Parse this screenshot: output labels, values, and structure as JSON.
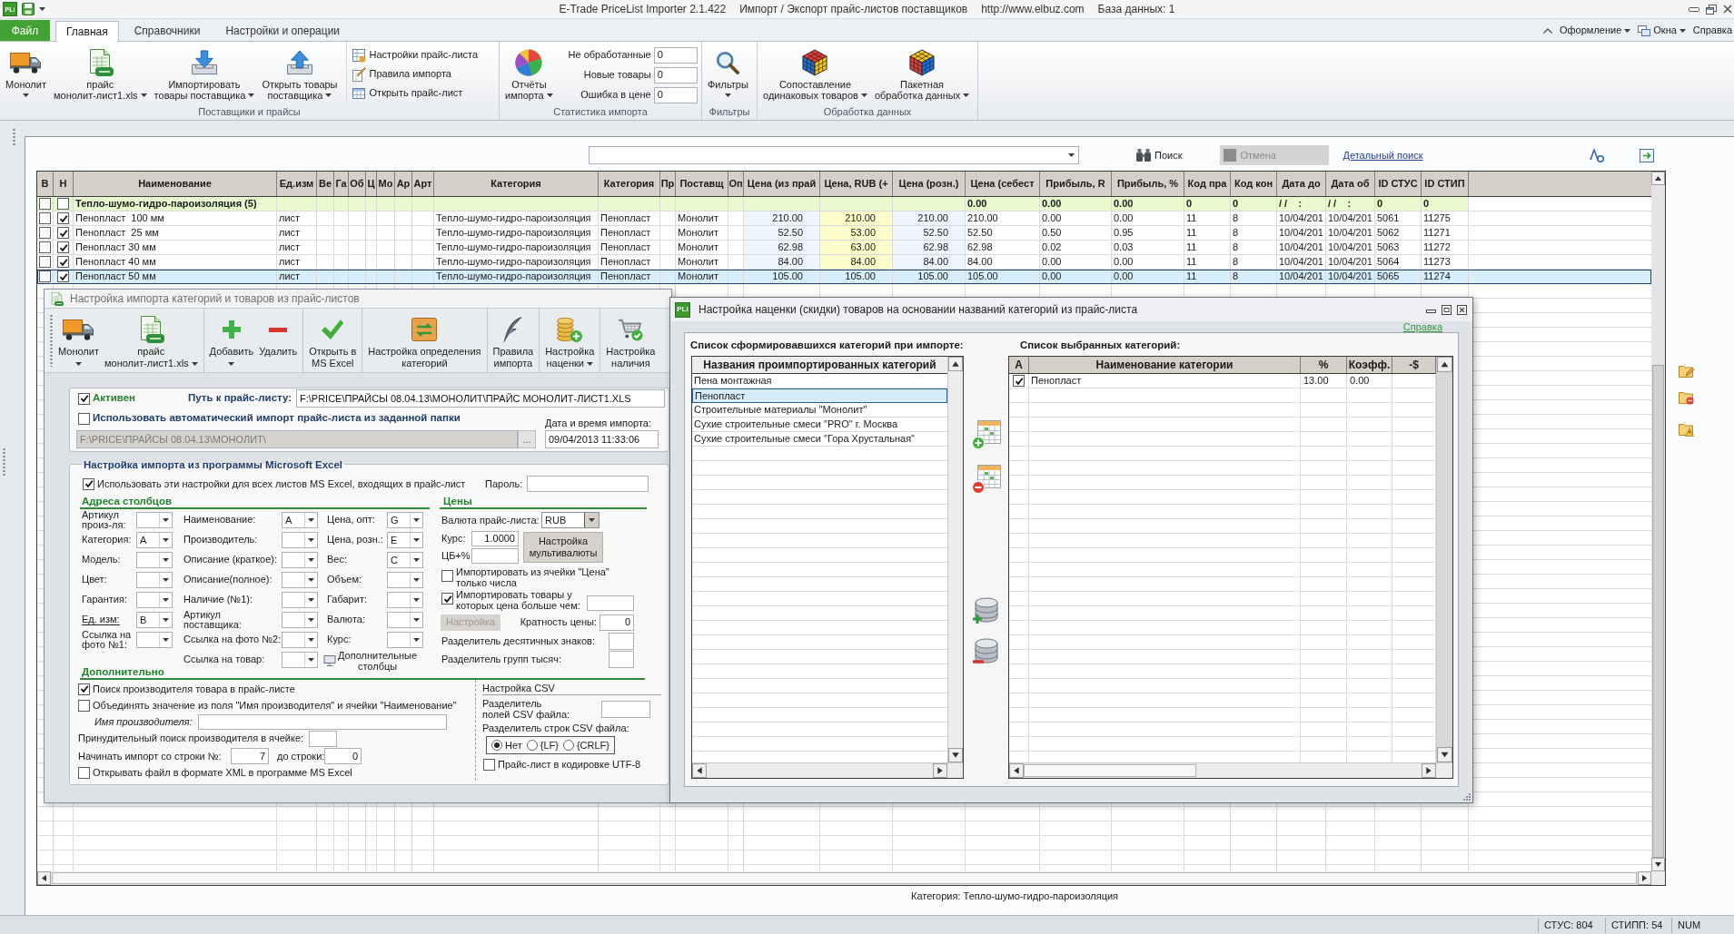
{
  "window": {
    "logo": "PLi",
    "title": "E-Trade PriceList Importer 2.1.422",
    "subtitle": "Импорт / Экспорт прайс-листов поставщиков",
    "website": "http://www.elbuz.com",
    "database": "База данных: 1"
  },
  "ribbon": {
    "tabs": [
      {
        "label": "Файл",
        "kind": "file",
        "selected": false
      },
      {
        "label": "Главная",
        "kind": "tab",
        "selected": true
      },
      {
        "label": "Справочники",
        "kind": "tab",
        "selected": false
      },
      {
        "label": "Настройки и операции",
        "kind": "tab",
        "selected": false
      }
    ],
    "menus": [
      {
        "label": "Оформление",
        "dropdown": true
      },
      {
        "label": "Окна",
        "dropdown": true
      },
      {
        "label": "Справка",
        "dropdown": false
      }
    ],
    "groups": [
      {
        "label": "Поставщики и прайсы",
        "items": [
          {
            "kind": "large",
            "lines": [
              "Монолит"
            ],
            "dropdown": true
          },
          {
            "kind": "large",
            "lines": [
              "прайс",
              "монолит-лист1.xls"
            ],
            "dropdown": true
          },
          {
            "kind": "large",
            "lines": [
              "Импортировать",
              "товары поставщика"
            ],
            "dropdown": true
          },
          {
            "kind": "large",
            "lines": [
              "Открыть товары",
              "поставщика"
            ],
            "dropdown": true
          },
          {
            "kind": "small",
            "buttons": [
              "Настройки прайс-листа",
              "Правила импорта",
              "Открыть прайс-лист"
            ]
          }
        ]
      },
      {
        "label": "Статистика импорта",
        "items": [
          {
            "kind": "large",
            "lines": [
              "Отчёты",
              "импорта"
            ],
            "dropdown": true
          },
          {
            "kind": "stats",
            "fields": [
              {
                "label": "Не обработанные",
                "value": "0"
              },
              {
                "label": "Новые товары",
                "value": "0"
              },
              {
                "label": "Ошибка в цене",
                "value": "0"
              }
            ]
          }
        ]
      },
      {
        "label": "Фильтры",
        "items": [
          {
            "kind": "large",
            "lines": [
              "Фильтры"
            ],
            "dropdown": true
          }
        ]
      },
      {
        "label": "Обработка данных",
        "items": [
          {
            "kind": "large",
            "lines": [
              "Сопоставление",
              "одинаковых товаров"
            ],
            "dropdown": true
          },
          {
            "kind": "large",
            "lines": [
              "Пакетная",
              "обработка данных"
            ],
            "dropdown": true
          }
        ]
      }
    ]
  },
  "search": {
    "buttons": [
      {
        "label": "Поиск",
        "disabled": false
      },
      {
        "label": "Отмена",
        "disabled": true
      }
    ],
    "link": "Детальный поиск"
  },
  "grid": {
    "columns": [
      {
        "label": "В",
        "kind": "check"
      },
      {
        "label": "Н",
        "kind": "check"
      },
      {
        "label": "Наименование",
        "kind": "text"
      },
      {
        "label": "Ед.изм",
        "kind": "text"
      },
      {
        "label": "Ве",
        "kind": "text"
      },
      {
        "label": "Га",
        "kind": "text"
      },
      {
        "label": "Об",
        "kind": "text"
      },
      {
        "label": "Ц",
        "kind": "text"
      },
      {
        "label": "Мо",
        "kind": "text"
      },
      {
        "label": "Ар",
        "kind": "text"
      },
      {
        "label": "Арт",
        "kind": "text"
      },
      {
        "label": "Категория",
        "kind": "text"
      },
      {
        "label": "Категория",
        "kind": "text"
      },
      {
        "label": "Пр",
        "kind": "text"
      },
      {
        "label": "Поставщ",
        "kind": "text"
      },
      {
        "label": "Оп",
        "kind": "text"
      },
      {
        "label": "Цена (из прай",
        "kind": "price",
        "color": "#eef6fd"
      },
      {
        "label": "Цена, RUB (+",
        "kind": "price",
        "color": "#fdfccb"
      },
      {
        "label": "Цена (розн.)",
        "kind": "price",
        "color": "#eef6fd"
      },
      {
        "label": "Цена (себест",
        "kind": "text"
      },
      {
        "label": "Прибыль, R",
        "kind": "text"
      },
      {
        "label": "Прибыль, %",
        "kind": "text"
      },
      {
        "label": "Код пра",
        "kind": "text"
      },
      {
        "label": "Код кон",
        "kind": "text"
      },
      {
        "label": "Дата до",
        "kind": "text"
      },
      {
        "label": "Дата об",
        "kind": "text"
      },
      {
        "label": "ID СТУС",
        "kind": "text"
      },
      {
        "label": "ID СТИП",
        "kind": "text"
      }
    ],
    "rows": [
      {
        "kind": "group",
        "selected": false,
        "cells": [
          {
            "checked": false
          },
          {
            "checked": false
          },
          "Тепло-шумо-гидро-пароизоляция (5)",
          null,
          null,
          null,
          null,
          null,
          null,
          null,
          null,
          null,
          null,
          null,
          null,
          null,
          null,
          null,
          null,
          "0.00",
          "0.00",
          "0.00",
          "0",
          "0",
          "/ /    :",
          "/ /    :",
          "0",
          "0"
        ]
      },
      {
        "kind": "item",
        "selected": false,
        "cells": [
          {
            "checked": false
          },
          {
            "checked": true
          },
          "Пенопласт  100 мм",
          "лист",
          null,
          null,
          null,
          null,
          null,
          null,
          null,
          "Тепло-шумо-гидро-пароизоляция",
          "Пенопласт",
          null,
          "Монолит",
          null,
          "210.00",
          "210.00",
          "210.00",
          "210.00",
          "0.00",
          "0.00",
          "11",
          "8",
          "10/04/201",
          "10/04/201",
          "5061",
          "11275"
        ]
      },
      {
        "kind": "item",
        "selected": false,
        "cells": [
          {
            "checked": false
          },
          {
            "checked": true
          },
          "Пенопласт  25 мм",
          "лист",
          null,
          null,
          null,
          null,
          null,
          null,
          null,
          "Тепло-шумо-гидро-пароизоляция",
          "Пенопласт",
          null,
          "Монолит",
          null,
          "52.50",
          "53.00",
          "52.50",
          "52.50",
          "0.50",
          "0.95",
          "11",
          "8",
          "10/04/201",
          "10/04/201",
          "5062",
          "11271"
        ]
      },
      {
        "kind": "item",
        "selected": false,
        "cells": [
          {
            "checked": false
          },
          {
            "checked": true
          },
          "Пенопласт 30 мм",
          "лист",
          null,
          null,
          null,
          null,
          null,
          null,
          null,
          "Тепло-шумо-гидро-пароизоляция",
          "Пенопласт",
          null,
          "Монолит",
          null,
          "62.98",
          "63.00",
          "62.98",
          "62.98",
          "0.02",
          "0.03",
          "11",
          "8",
          "10/04/201",
          "10/04/201",
          "5063",
          "11272"
        ]
      },
      {
        "kind": "item",
        "selected": false,
        "cells": [
          {
            "checked": false
          },
          {
            "checked": true
          },
          "Пенопласт 40 мм",
          "лист",
          null,
          null,
          null,
          null,
          null,
          null,
          null,
          "Тепло-шумо-гидро-пароизоляция",
          "Пенопласт",
          null,
          "Монолит",
          null,
          "84.00",
          "84.00",
          "84.00",
          "84.00",
          "0.00",
          "0.00",
          "11",
          "8",
          "10/04/201",
          "10/04/201",
          "5064",
          "11273"
        ]
      },
      {
        "kind": "item",
        "selected": true,
        "cells": [
          {
            "checked": false
          },
          {
            "checked": true
          },
          "Пенопласт 50 мм",
          "лист",
          null,
          null,
          null,
          null,
          null,
          null,
          null,
          "Тепло-шумо-гидро-пароизоляция",
          "Пенопласт",
          null,
          "Монолит",
          null,
          "105.00",
          "105.00",
          "105.00",
          "105.00",
          "0.00",
          "0.00",
          "11",
          "8",
          "10/04/201",
          "10/04/201",
          "5065",
          "11274"
        ]
      }
    ]
  },
  "import_dialog": {
    "title": "Настройка импорта категорий и товаров из прайс-листов",
    "toolbar": [
      {
        "buttons": [
          {
            "lines": [
              "Монолит"
            ],
            "dropdown": true
          },
          {
            "lines": [
              "прайс",
              "монолит-лист1.xls"
            ],
            "dropdown": true
          }
        ]
      },
      {
        "buttons": [
          {
            "lines": [
              "Добавить"
            ],
            "dropdown": true
          },
          {
            "lines": [
              "Удалить"
            ],
            "dropdown": false
          }
        ]
      },
      {
        "buttons": [
          {
            "lines": [
              "Открыть в",
              "MS Excel"
            ],
            "dropdown": false
          }
        ]
      },
      {
        "buttons": [
          {
            "lines": [
              "Настройка определения",
              "категорий"
            ],
            "dropdown": false
          }
        ]
      },
      {
        "buttons": [
          {
            "lines": [
              "Правила",
              "импорта"
            ],
            "dropdown": false
          }
        ]
      },
      {
        "buttons": [
          {
            "lines": [
              "Настройка",
              "наценки"
            ],
            "dropdown": true
          }
        ]
      },
      {
        "buttons": [
          {
            "lines": [
              "Настройка",
              "наличия"
            ],
            "dropdown": false
          }
        ]
      }
    ],
    "active": {
      "label": "Активен",
      "checked": true
    },
    "path": {
      "label": "Путь к прайс-листу:",
      "value": "F:\\PRICE\\ПРАЙСЫ 08.04.13\\МОНОЛИТ\\ПРАЙС МОНОЛИТ-ЛИСТ1.XLS"
    },
    "auto_import": {
      "label": "Использовать автоматический импорт прайс-листа из заданной папки",
      "checked": false,
      "folder": "F:\\PRICE\\ПРАЙСЫ 08.04.13\\МОНОЛИТ\\",
      "browse": "..."
    },
    "import_time": {
      "label": "Дата и время импорта:",
      "value": "09/04/2013 11:33:06"
    },
    "excel": {
      "title": "Настройка импорта из программы Microsoft Excel",
      "all_sheets": {
        "label": "Использовать эти настройки для всех листов MS Excel, входящих в прайс-лист",
        "checked": true
      },
      "password_label": "Пароль:",
      "columns_title": "Адреса столбцов",
      "column_groups": [
        [
          {
            "label": "Артикул\nпроиз-ля:",
            "underlined": false
          },
          {
            "label": "Категория:",
            "value": "A",
            "underlined": false
          },
          {
            "label": "Модель:",
            "underlined": false
          },
          {
            "label": "Цвет:",
            "underlined": false
          },
          {
            "label": "Гарантия:",
            "underlined": false
          },
          {
            "label": "Ед. изм:",
            "value": "B",
            "underlined": true
          },
          {
            "label": "Ссылка на\nфото №1:",
            "underlined": false
          }
        ],
        [
          {
            "label": "Наименование:",
            "value": "A",
            "underlined": false
          },
          {
            "label": "Производитель:",
            "underlined": false
          },
          {
            "label": "Описание (краткое):",
            "underlined": false
          },
          {
            "label": "Описание(полное):",
            "underlined": false
          },
          {
            "label": "Наличие (№1):",
            "underlined": false
          },
          {
            "label": "Артикул\nпоставщика:",
            "underlined": false
          },
          {
            "label": "Ссылка на фото №2:",
            "underlined": false
          },
          {
            "label": "Ссылка на товар:",
            "underlined": false
          }
        ],
        [
          {
            "label": "Цена, опт:",
            "value": "G",
            "underlined": false
          },
          {
            "label": "Цена, розн.:",
            "value": "E",
            "underlined": false
          },
          {
            "label": "Вес:",
            "value": "C",
            "underlined": false
          },
          {
            "label": "Объем:",
            "underlined": false
          },
          {
            "label": "Габарит:",
            "underlined": false
          },
          {
            "label": "Валюта:",
            "underlined": false
          },
          {
            "label": "Курс:",
            "underlined": false
          }
        ]
      ],
      "extra_columns": "Дополнительные\nстолбцы",
      "prices": {
        "title": "Цены",
        "currency": {
          "label": "Валюта прайс-листа:",
          "value": "RUB"
        },
        "rate": {
          "label": "Курс:",
          "value": "1.0000"
        },
        "cb_label": "ЦБ+%",
        "multicurrency": "Настройка\nмультивалюты",
        "numbers_only": {
          "label": "Импортировать из ячейки \"Цена\"\nтолько числа",
          "checked": false
        },
        "min_price": {
          "label": "Импортировать товары у\nкоторых цена больше чем:",
          "checked": true
        },
        "settings_button": {
          "label": "Настройка",
          "disabled": true
        },
        "multiplicity": {
          "label": "Кратность цены:",
          "value": "0"
        },
        "decimal_separator": "Разделитель десятичных знаков:",
        "thousands_separator": "Разделитель групп тысяч:"
      },
      "extra_title": "Дополнительно",
      "options": [
        {
          "label": "Поиск производителя товара в прайс-листе",
          "checked": true
        },
        {
          "label": "Объединять значение из поля \"Имя производителя\" и ячейки \"Наименование\"",
          "checked": false
        }
      ],
      "maker_name_label": "Имя производителя:",
      "forced_search_label": "Принудительный поиск производителя в ячейке:",
      "start_row": {
        "label": "Начинать импорт со строки №:",
        "value": "7"
      },
      "end_row": {
        "label": "до строки:",
        "value": "0"
      },
      "open_xml": {
        "label": "Открывать файл в формате XML в программе MS Excel",
        "checked": false
      },
      "csv": {
        "title": "Настройка CSV",
        "field_separator_label": "Разделитель\nполей CSV файла:",
        "line_separator_label": "Разделитель строк CSV файла:",
        "line_separators": [
          {
            "label": "Нет",
            "selected": true
          },
          {
            "label": "{LF}",
            "selected": false
          },
          {
            "label": "{CRLF}",
            "selected": false
          }
        ],
        "utf8": {
          "label": "Прайс-лист в кодировке UTF-8",
          "checked": false
        }
      }
    }
  },
  "markup_dialog": {
    "logo": "PLi",
    "title": "Настройка наценки (скидки) товаров на основании названий категорий из прайс-листа",
    "help_link": "Справка",
    "source": {
      "title": "Список сформировавшихся категорий при импорте:",
      "header": "Названия проимпортированных категорий",
      "items": [
        {
          "label": "Пена монтажная",
          "selected": false
        },
        {
          "label": "Пенопласт",
          "selected": true
        },
        {
          "label": "Строительные материалы \"Монолит\"",
          "selected": false
        },
        {
          "label": "Сухие строительные смеси \"PRO\" г. Москва",
          "selected": false
        },
        {
          "label": "Сухие строительные смеси \"Гора Хрустальная\"",
          "selected": false
        }
      ]
    },
    "target": {
      "title": "Список выбранных категорий:",
      "columns": [
        "А",
        "Наименование категории",
        "%",
        "Коэфф.",
        "-$"
      ],
      "rows": [
        {
          "checked": true,
          "name": "Пенопласт",
          "percent": "13.00",
          "coefficient": "0.00"
        }
      ]
    }
  },
  "footer": "Категория: Тепло-шумо-гидро-пароизоляция",
  "status_bar": [
    "СТУС: 804",
    "СТИПП: 54",
    "NUM"
  ]
}
